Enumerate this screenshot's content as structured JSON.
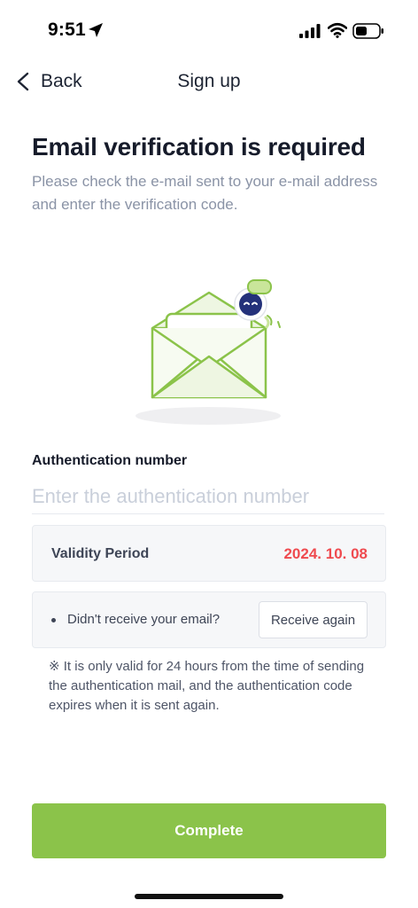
{
  "status_bar": {
    "time": "9:51",
    "icons": [
      "location-arrow-icon",
      "signal-icon",
      "wifi-icon",
      "battery-icon"
    ]
  },
  "nav": {
    "back_label": "Back",
    "title": "Sign up"
  },
  "heading": {
    "title": "Email verification is required",
    "description": "Please check the e-mail sent to your e-mail address and enter the verification code."
  },
  "illustration": {
    "name": "envelope-with-robot-illustration",
    "accent_color": "#8bc34a",
    "robot_color": "#24317a"
  },
  "auth": {
    "label": "Authentication number",
    "placeholder": "Enter the authentication number",
    "value": ""
  },
  "validity": {
    "label": "Validity Period",
    "date": "2024. 10. 08",
    "date_color": "#ef4a4f"
  },
  "resend": {
    "question": "Didn't receive your email?",
    "button_label": "Receive again"
  },
  "note": "※ It is only valid for 24 hours from the time of sending the authentication mail, and the authentication code expires when it is sent again.",
  "complete_button": {
    "label": "Complete",
    "color": "#8bc34a"
  }
}
